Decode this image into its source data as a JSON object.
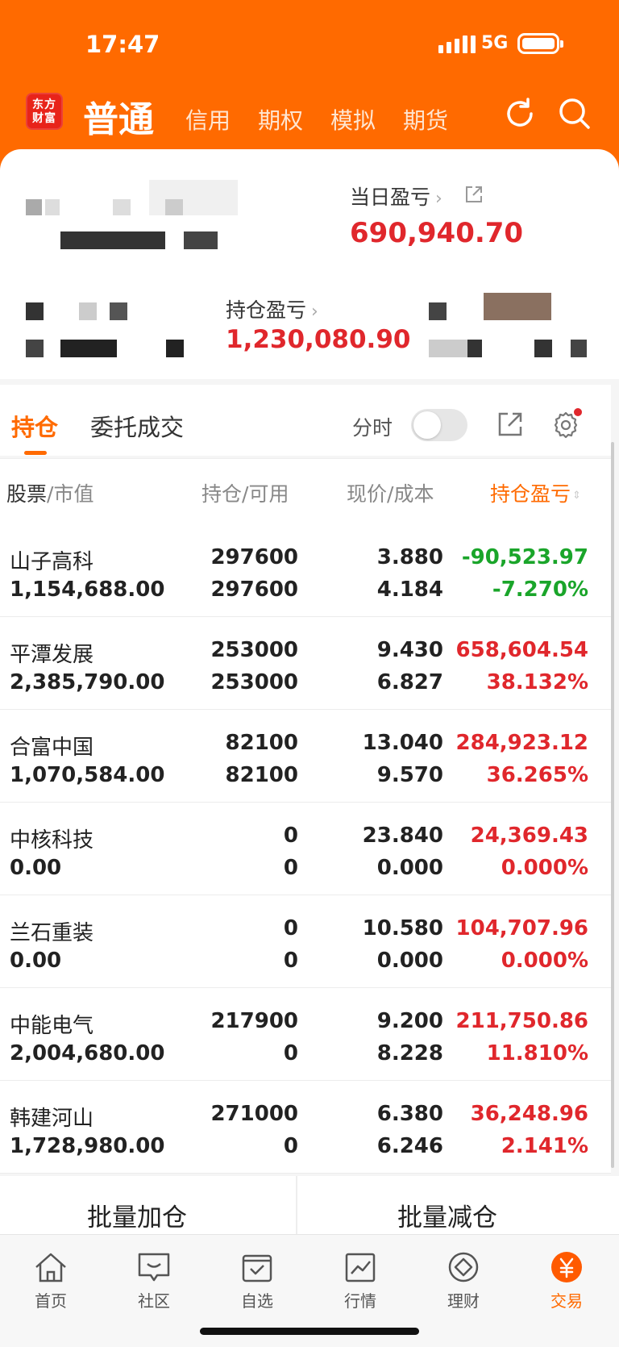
{
  "status": {
    "time": "17:47",
    "network": "5G"
  },
  "header": {
    "logo_line1": "东方",
    "logo_line2": "财富",
    "active_tab": "普通",
    "tabs": [
      "信用",
      "期权",
      "模拟",
      "期货"
    ]
  },
  "summary": {
    "daily_pl_label": "当日盈亏",
    "daily_pl_value": "690,940.70",
    "position_pl_label": "持仓盈亏",
    "position_pl_value": "1,230,080.90"
  },
  "tabs": {
    "holdings": "持仓",
    "orders": "委托成交",
    "intraday_label": "分时"
  },
  "table": {
    "headers": {
      "stock": "股票",
      "market_value": "市值",
      "position": "持仓",
      "available": "可用",
      "price": "现价",
      "cost": "成本",
      "pl": "持仓盈亏",
      "sep": "/"
    },
    "rows": [
      {
        "name": "山子高科",
        "market_value": "1,154,688.00",
        "position": "297600",
        "available": "297600",
        "price": "3.880",
        "cost": "4.184",
        "pl": "-90,523.97",
        "pl_pct": "-7.270%",
        "trend": "down"
      },
      {
        "name": "平潭发展",
        "market_value": "2,385,790.00",
        "position": "253000",
        "available": "253000",
        "price": "9.430",
        "cost": "6.827",
        "pl": "658,604.54",
        "pl_pct": "38.132%",
        "trend": "up"
      },
      {
        "name": "合富中国",
        "market_value": "1,070,584.00",
        "position": "82100",
        "available": "82100",
        "price": "13.040",
        "cost": "9.570",
        "pl": "284,923.12",
        "pl_pct": "36.265%",
        "trend": "up"
      },
      {
        "name": "中核科技",
        "market_value": "0.00",
        "position": "0",
        "available": "0",
        "price": "23.840",
        "cost": "0.000",
        "pl": "24,369.43",
        "pl_pct": "0.000%",
        "trend": "up"
      },
      {
        "name": "兰石重装",
        "market_value": "0.00",
        "position": "0",
        "available": "0",
        "price": "10.580",
        "cost": "0.000",
        "pl": "104,707.96",
        "pl_pct": "0.000%",
        "trend": "up"
      },
      {
        "name": "中能电气",
        "market_value": "2,004,680.00",
        "position": "217900",
        "available": "0",
        "price": "9.200",
        "cost": "8.228",
        "pl": "211,750.86",
        "pl_pct": "11.810%",
        "trend": "up"
      },
      {
        "name": "韩建河山",
        "market_value": "1,728,980.00",
        "position": "271000",
        "available": "0",
        "price": "6.380",
        "cost": "6.246",
        "pl": "36,248.96",
        "pl_pct": "2.141%",
        "trend": "up"
      }
    ]
  },
  "batch": {
    "add": "批量加仓",
    "reduce": "批量减仓"
  },
  "bottom_nav": [
    {
      "label": "首页",
      "icon": "home-icon"
    },
    {
      "label": "社区",
      "icon": "chat-icon"
    },
    {
      "label": "自选",
      "icon": "watchlist-icon"
    },
    {
      "label": "行情",
      "icon": "market-chart-icon"
    },
    {
      "label": "理财",
      "icon": "wealth-icon"
    },
    {
      "label": "交易",
      "icon": "yen-icon",
      "active": true
    }
  ],
  "colors": {
    "brand": "#ff6a00",
    "up": "#e0272c",
    "down": "#1aa52a"
  }
}
